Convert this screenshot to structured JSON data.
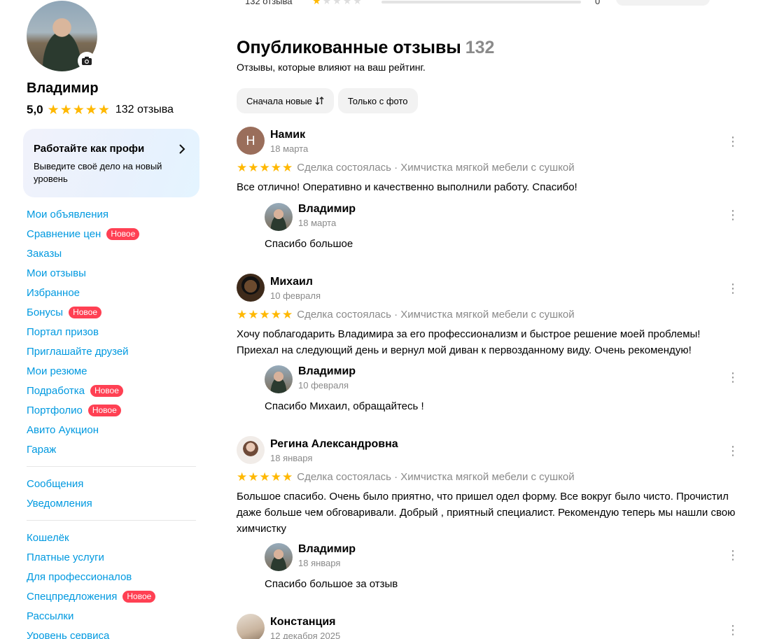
{
  "profile": {
    "name": "Владимир",
    "rating": "5,0",
    "reviews_link": "132 отзыва"
  },
  "promo": {
    "title": "Работайте как профи",
    "text": "Выведите своё дело на новый уровень"
  },
  "menu": {
    "group1": [
      {
        "label": "Мои объявления"
      },
      {
        "label": "Сравнение цен",
        "badge": "Новое"
      },
      {
        "label": "Заказы"
      },
      {
        "label": "Мои отзывы"
      },
      {
        "label": "Избранное"
      },
      {
        "label": "Бонусы",
        "badge": "Новое"
      },
      {
        "label": "Портал призов"
      },
      {
        "label": "Приглашайте друзей"
      },
      {
        "label": "Мои резюме"
      },
      {
        "label": "Подработка",
        "badge": "Новое"
      },
      {
        "label": "Портфолио",
        "badge": "Новое"
      },
      {
        "label": "Авито Аукцион"
      },
      {
        "label": "Гараж"
      }
    ],
    "group2": [
      {
        "label": "Сообщения"
      },
      {
        "label": "Уведомления"
      }
    ],
    "group3": [
      {
        "label": "Кошелёк"
      },
      {
        "label": "Платные услуги"
      },
      {
        "label": "Для профессионалов"
      },
      {
        "label": "Спецпредложения",
        "badge": "Новое"
      },
      {
        "label": "Рассылки"
      },
      {
        "label": "Уровень сервиса"
      }
    ]
  },
  "top_strip": {
    "count": "132 отзыва",
    "zero": "0",
    "stars_filled": 1
  },
  "main": {
    "heading": "Опубликованные отзывы",
    "heading_count": "132",
    "subheading": "Отзывы, которые влияют на ваш рейтинг.",
    "filter_new": "Сначала новые",
    "filter_photo": "Только с фото"
  },
  "reviews": [
    {
      "author": "Намик",
      "initial": "Н",
      "date": "18 марта",
      "meta": "Сделка состоялась · Химчистка мягкой мебели с сушкой",
      "text": "Все отлично! Оперативно и качественно выполнили работу. Спасибо!",
      "reply": {
        "author": "Владимир",
        "date": "18 марта",
        "text": "Спасибо большое"
      }
    },
    {
      "author": "Михаил",
      "date": "10 февраля",
      "meta": "Сделка состоялась · Химчистка мягкой мебели с сушкой",
      "text": "Хочу поблагодарить Владимира за его профессионализм и быстрое решение моей проблемы! Приехал на следующий день и вернул мой диван к первозданному виду. Очень рекомендую!",
      "reply": {
        "author": "Владимир",
        "date": "10 февраля",
        "text": "Спасибо Михаил, обращайтесь !"
      }
    },
    {
      "author": "Регина Александровна",
      "date": "18 января",
      "meta": "Сделка состоялась · Химчистка мягкой мебели с сушкой",
      "text": "Большое спасибо. Очень было приятно, что пришел одел форму. Все вокруг было чисто. Прочистил даже больше чем обговаривали. Добрый , приятный специалист. Рекомендую теперь мы нашли свою химчистку",
      "reply": {
        "author": "Владимир",
        "date": "18 января",
        "text": "Спасибо большое за отзыв"
      }
    },
    {
      "author": "Констанция",
      "date": "12 декабря 2025"
    }
  ],
  "icons": {
    "camera": "camera-icon",
    "star": "star-icon",
    "chevron": "chevron-right-icon",
    "sort": "sort-icon",
    "more": "more-vertical-icon"
  },
  "colors": {
    "link": "#0099e0",
    "badge": "#ff4053",
    "star": "#ffb800"
  }
}
